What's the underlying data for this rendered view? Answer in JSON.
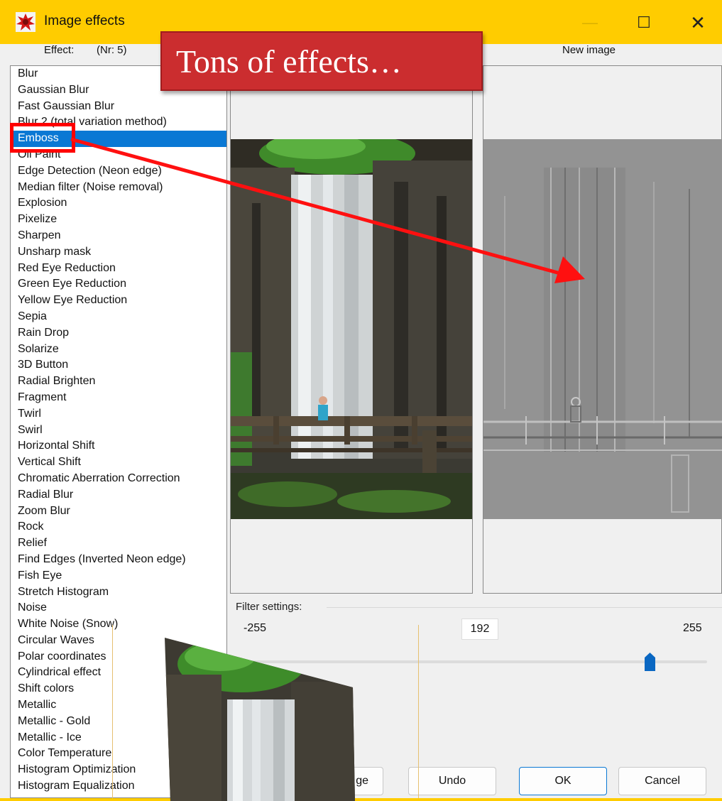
{
  "window": {
    "title": "Image effects",
    "minimize_glyph": "—",
    "maximize_glyph": "☐",
    "close_glyph": "✕"
  },
  "headers": {
    "effect_label": "Effect:",
    "effect_nr": "(Nr: 5)",
    "new_image": "New image"
  },
  "effects": {
    "selected_index": 4,
    "items": [
      "Blur",
      "Gaussian Blur",
      "Fast Gaussian Blur",
      "Blur 2 (total variation method)",
      "Emboss",
      "Oil Paint",
      "Edge Detection (Neon edge)",
      "Median filter (Noise removal)",
      "Explosion",
      "Pixelize",
      "Sharpen",
      "Unsharp mask",
      "Red Eye Reduction",
      "Green Eye Reduction",
      "Yellow Eye Reduction",
      "Sepia",
      "Rain Drop",
      "Solarize",
      "3D Button",
      "Radial Brighten",
      "Fragment",
      "Twirl",
      "Swirl",
      "Horizontal Shift",
      "Vertical Shift",
      "Chromatic Aberration Correction",
      "Radial Blur",
      "Zoom Blur",
      "Rock",
      "Relief",
      "Find Edges (Inverted Neon edge)",
      "Fish Eye",
      "Stretch Histogram",
      "Noise",
      "White Noise (Snow)",
      "Circular Waves",
      "Polar coordinates",
      "Cylindrical effect",
      "Shift colors",
      "Metallic",
      "Metallic - Gold",
      "Metallic - Ice",
      "Color Temperature",
      "Histogram Optimization",
      "Histogram Equalization"
    ]
  },
  "filter": {
    "label": "Filter settings:",
    "min": "-255",
    "max": "255",
    "value": "192",
    "value_num": 192,
    "range": [
      -255,
      255
    ]
  },
  "buttons": {
    "partial": "ge",
    "undo": "Undo",
    "ok": "OK",
    "cancel": "Cancel"
  },
  "annotation": {
    "callout": "Tons of effects…"
  },
  "colors": {
    "title_bar": "#ffcc00",
    "selection": "#0a78d4",
    "callout": "#cb2d2f",
    "highlight": "#ff0000"
  },
  "icons": {
    "app": "image-effects-app-icon",
    "thumb": "slider-thumb"
  }
}
